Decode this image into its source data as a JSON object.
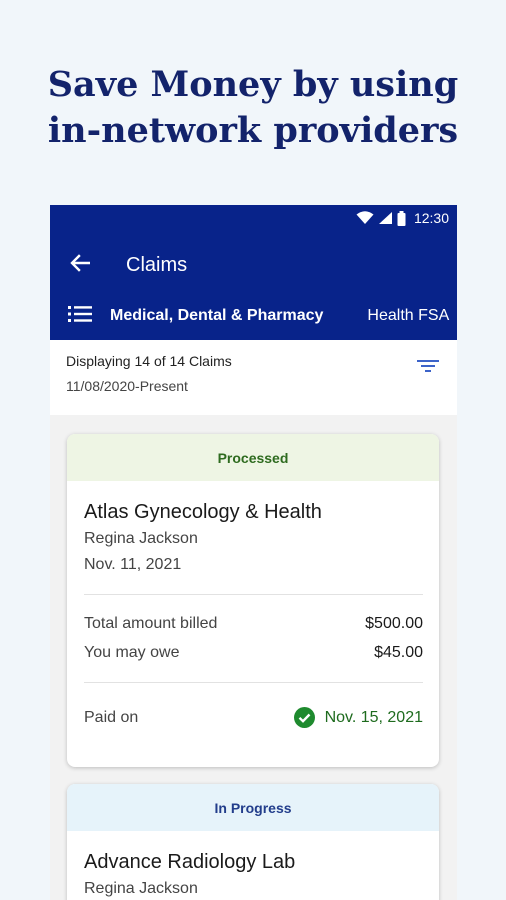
{
  "headline": {
    "line1": "Save Money by using",
    "line2": "in-network providers"
  },
  "statusbar": {
    "time": "12:30",
    "icons": [
      "wifi-icon",
      "signal-icon",
      "battery-icon"
    ]
  },
  "toolbar": {
    "back_icon": "arrow-left-icon",
    "title": "Claims"
  },
  "tabs": {
    "menu_icon": "list-icon",
    "items": [
      {
        "label": "Medical, Dental & Pharmacy",
        "active": true
      },
      {
        "label": "Health FSA",
        "active": false
      }
    ]
  },
  "summary": {
    "count": "Displaying 14 of 14 Claims",
    "range": "11/08/2020-Present",
    "filter_icon": "filter-icon"
  },
  "claims": [
    {
      "status": "Processed",
      "provider": "Atlas Gynecology & Health",
      "patient": "Regina Jackson",
      "date": "Nov. 11, 2021",
      "billed_label": "Total amount billed",
      "billed_value": "$500.00",
      "owe_label": "You may owe",
      "owe_value": "$45.00",
      "paid_label": "Paid on",
      "paid_value": "Nov. 15, 2021"
    },
    {
      "status": "In Progress",
      "provider": "Advance Radiology Lab",
      "patient": "Regina Jackson"
    }
  ],
  "colors": {
    "brand": "#08238a",
    "headline": "#13236b",
    "processed_bg": "#eef5e4",
    "processed_text": "#2e6b1f",
    "in_progress_bg": "#e6f3fa",
    "paid_green": "#1e8a2e"
  }
}
